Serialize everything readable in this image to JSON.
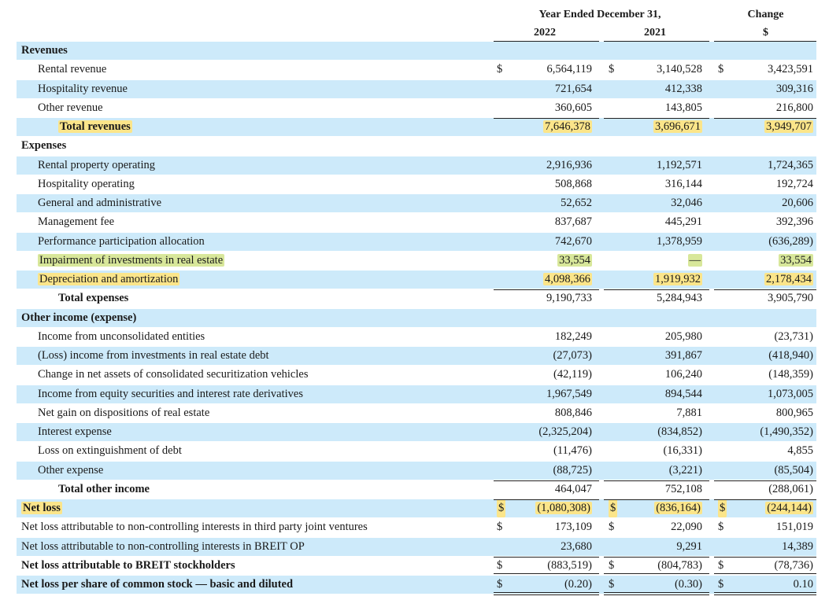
{
  "header": {
    "period": "Year Ended December 31,",
    "year_2022": "2022",
    "year_2021": "2021",
    "change": "Change",
    "change_unit": "$"
  },
  "colors": {
    "shade": "#cdeafa",
    "highlight_yellow": "#fbe58a",
    "highlight_green": "#d8e79a"
  },
  "rows": [
    {
      "label": "Revenues",
      "bold": true,
      "indent": 0
    },
    {
      "label": "Rental revenue",
      "indent": 1,
      "cur": true,
      "v": [
        "6,564,119",
        "3,140,528",
        "3,423,591"
      ]
    },
    {
      "label": "Hospitality revenue",
      "indent": 1,
      "v": [
        "721,654",
        "412,338",
        "309,316"
      ]
    },
    {
      "label": "Other revenue",
      "indent": 1,
      "v": [
        "360,605",
        "143,805",
        "216,800"
      ]
    },
    {
      "label": "Total revenues",
      "bold": true,
      "indent": 2,
      "hl": "y",
      "hlv": "y",
      "topline": true,
      "v": [
        "7,646,378",
        "3,696,671",
        "3,949,707"
      ]
    },
    {
      "label": "Expenses",
      "bold": true,
      "indent": 0
    },
    {
      "label": "Rental property operating",
      "indent": 1,
      "v": [
        "2,916,936",
        "1,192,571",
        "1,724,365"
      ]
    },
    {
      "label": "Hospitality operating",
      "indent": 1,
      "v": [
        "508,868",
        "316,144",
        "192,724"
      ]
    },
    {
      "label": "General and administrative",
      "indent": 1,
      "v": [
        "52,652",
        "32,046",
        "20,606"
      ]
    },
    {
      "label": "Management fee",
      "indent": 1,
      "v": [
        "837,687",
        "445,291",
        "392,396"
      ]
    },
    {
      "label": "Performance participation allocation",
      "indent": 1,
      "v": [
        "742,670",
        "1,378,959",
        "(636,289)"
      ]
    },
    {
      "label": "Impairment of investments in real estate",
      "indent": 1,
      "hl": "g",
      "hlv": "g",
      "v": [
        "33,554",
        "—",
        "33,554"
      ]
    },
    {
      "label": "Depreciation and amortization",
      "indent": 1,
      "hl": "y",
      "hlv": "y",
      "v": [
        "4,098,366",
        "1,919,932",
        "2,178,434"
      ]
    },
    {
      "label": "Total expenses",
      "bold": true,
      "indent": 2,
      "topline": true,
      "v": [
        "9,190,733",
        "5,284,943",
        "3,905,790"
      ]
    },
    {
      "label": "Other income (expense)",
      "bold": true,
      "indent": 0
    },
    {
      "label": "Income from unconsolidated entities",
      "indent": 1,
      "v": [
        "182,249",
        "205,980",
        "(23,731)"
      ]
    },
    {
      "label": "(Loss) income from investments in real estate debt",
      "indent": 1,
      "v": [
        "(27,073)",
        "391,867",
        "(418,940)"
      ]
    },
    {
      "label": "Change in net assets of consolidated securitization vehicles",
      "indent": 1,
      "v": [
        "(42,119)",
        "106,240",
        "(148,359)"
      ]
    },
    {
      "label": "Income from equity securities and interest rate derivatives",
      "indent": 1,
      "v": [
        "1,967,549",
        "894,544",
        "1,073,005"
      ]
    },
    {
      "label": "Net gain on dispositions of real estate",
      "indent": 1,
      "v": [
        "808,846",
        "7,881",
        "800,965"
      ]
    },
    {
      "label": "Interest expense",
      "indent": 1,
      "v": [
        "(2,325,204)",
        "(834,852)",
        "(1,490,352)"
      ]
    },
    {
      "label": "Loss on extinguishment of debt",
      "indent": 1,
      "v": [
        "(11,476)",
        "(16,331)",
        "4,855"
      ]
    },
    {
      "label": "Other expense",
      "indent": 1,
      "v": [
        "(88,725)",
        "(3,221)",
        "(85,504)"
      ]
    },
    {
      "label": "Total other income",
      "bold": true,
      "indent": 2,
      "topline": true,
      "v": [
        "464,047",
        "752,108",
        "(288,061)"
      ]
    },
    {
      "label": "Net loss",
      "bold": true,
      "indent": 0,
      "hl": "y",
      "hlv": "y",
      "hlcur": true,
      "cur": true,
      "topline": true,
      "v": [
        "(1,080,308)",
        "(836,164)",
        "(244,144)"
      ]
    },
    {
      "label": "Net loss attributable to non-controlling interests in third party joint ventures",
      "indent": 0,
      "cur": true,
      "v": [
        "173,109",
        "22,090",
        "151,019"
      ]
    },
    {
      "label": "Net loss attributable to non-controlling interests in BREIT OP",
      "indent": 0,
      "v": [
        "23,680",
        "9,291",
        "14,389"
      ]
    },
    {
      "label": "Net loss attributable to BREIT stockholders",
      "bold": true,
      "indent": 0,
      "cur": true,
      "topline": true,
      "dbl": true,
      "v": [
        "(883,519)",
        "(804,783)",
        "(78,736)"
      ]
    },
    {
      "label": "Net loss per share of common stock — basic and diluted",
      "bold": true,
      "indent": 0,
      "cur": true,
      "dbl": true,
      "v": [
        "(0.20)",
        "(0.30)",
        "0.10"
      ]
    }
  ]
}
